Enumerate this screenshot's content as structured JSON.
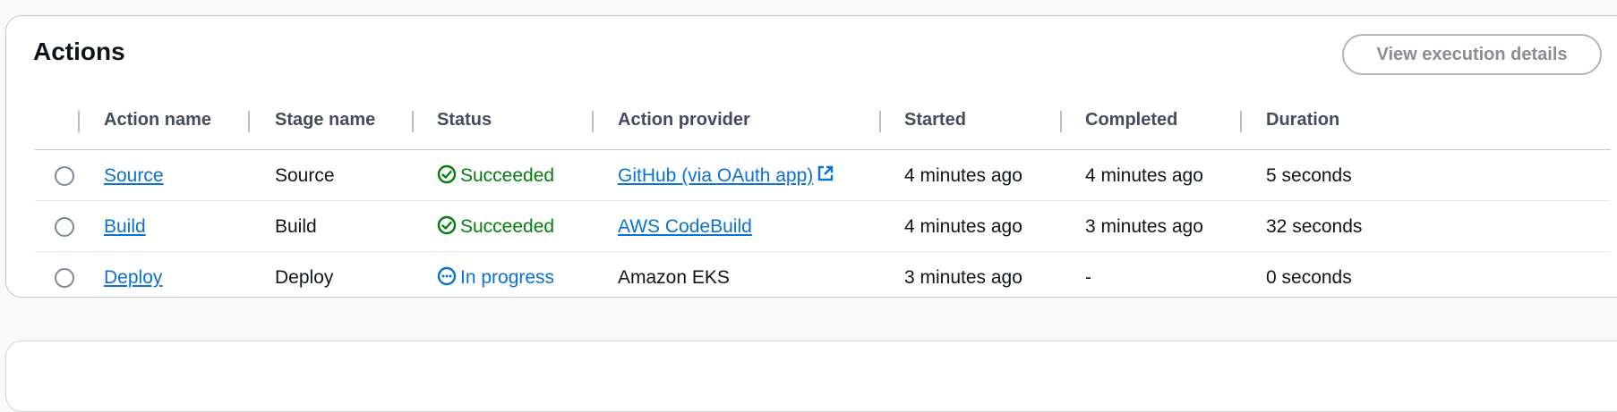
{
  "panel": {
    "title": "Actions",
    "view_button_label": "View execution details"
  },
  "table": {
    "headers": [
      "Action name",
      "Stage name",
      "Status",
      "Action provider",
      "Started",
      "Completed",
      "Duration"
    ],
    "rows": [
      {
        "action_name": "Source",
        "stage_name": "Source",
        "status": "Succeeded",
        "status_icon": "check-circle-icon",
        "action_provider": "GitHub (via OAuth app)",
        "provider_external": true,
        "started": "4 minutes ago",
        "completed": "4 minutes ago",
        "duration": "5 seconds"
      },
      {
        "action_name": "Build",
        "stage_name": "Build",
        "status": "Succeeded",
        "status_icon": "check-circle-icon",
        "action_provider": "AWS CodeBuild",
        "provider_external": false,
        "started": "4 minutes ago",
        "completed": "3 minutes ago",
        "duration": "32 seconds"
      },
      {
        "action_name": "Deploy",
        "stage_name": "Deploy",
        "status": "In progress",
        "status_icon": "in-progress-icon",
        "action_provider": "Amazon EKS",
        "provider_external": false,
        "started": "3 minutes ago",
        "completed": "-",
        "duration": "0 seconds"
      }
    ]
  },
  "colors": {
    "link": "#0972d3",
    "success": "#037f0c",
    "in_progress": "#0972d3",
    "header_text": "#414d5c",
    "border": "#c6c6cd"
  }
}
